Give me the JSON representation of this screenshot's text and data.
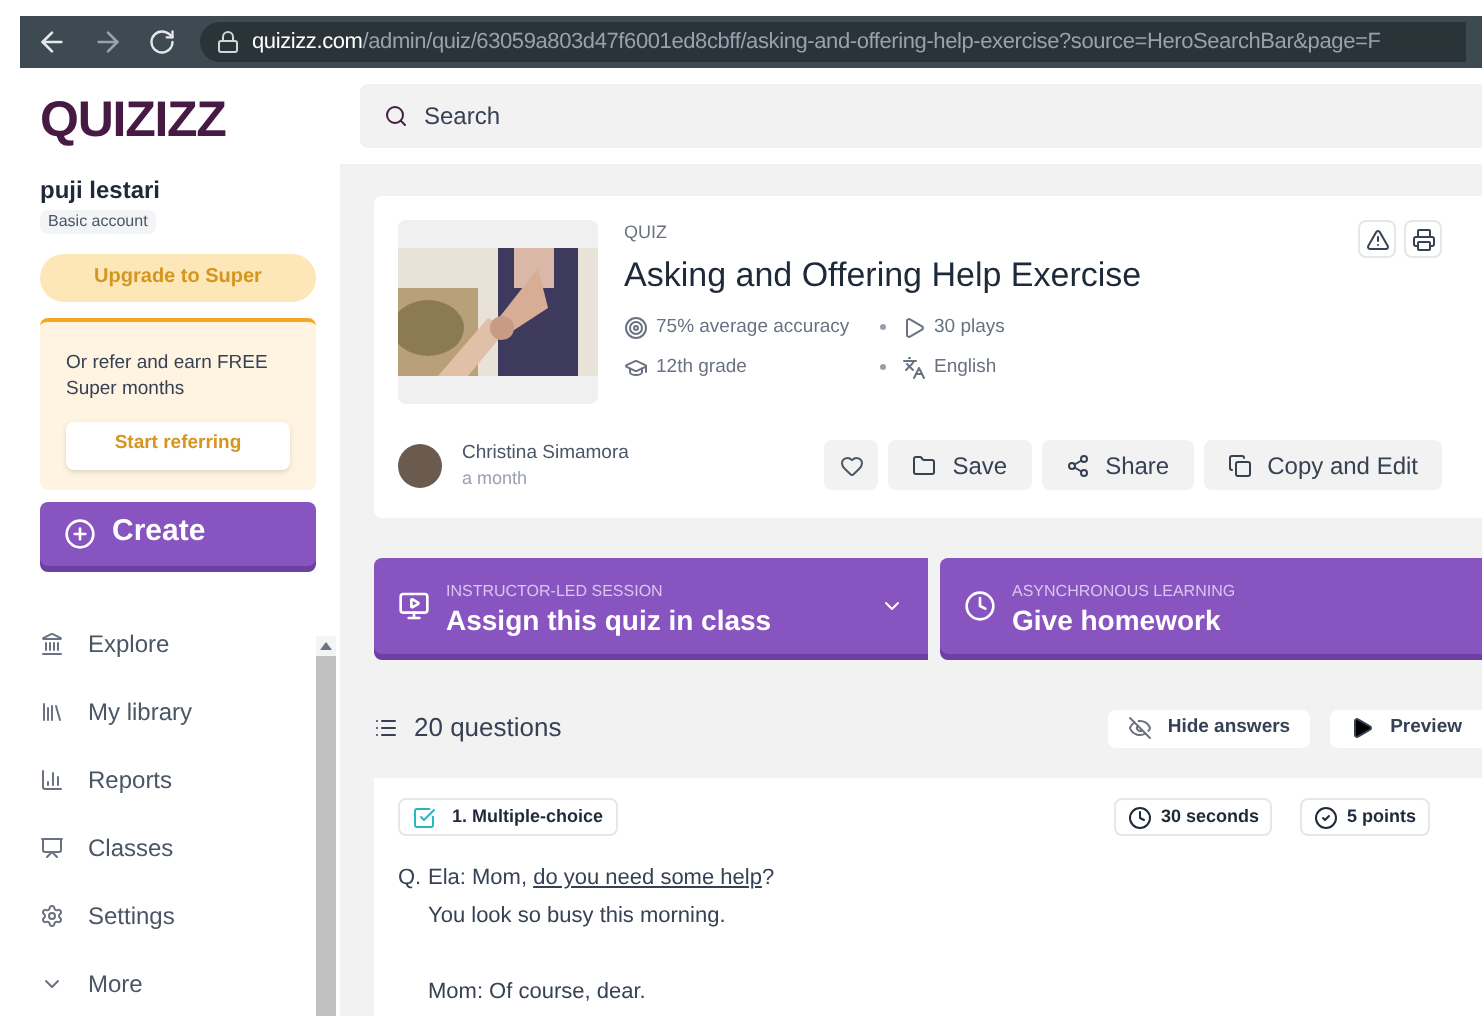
{
  "browser": {
    "url_host": "quizizz.com",
    "url_path": "/admin/quiz/63059a803d47f6001ed8cbff/asking-and-offering-help-exercise?source=HeroSearchBar&page=F"
  },
  "sidebar": {
    "logo": "QUIZIZZ",
    "user": "puji lestari",
    "account": "Basic account",
    "upgrade": "Upgrade to Super",
    "refer_text": "Or refer and earn FREE Super months",
    "refer_button": "Start referring",
    "create": "Create",
    "items": [
      {
        "label": "Explore"
      },
      {
        "label": "My library"
      },
      {
        "label": "Reports"
      },
      {
        "label": "Classes"
      },
      {
        "label": "Settings"
      },
      {
        "label": "More"
      }
    ]
  },
  "search": {
    "placeholder": "Search"
  },
  "quiz": {
    "type": "QUIZ",
    "title": "Asking and Offering Help Exercise",
    "accuracy": "75% average accuracy",
    "plays": "30 plays",
    "grade": "12th grade",
    "language": "English",
    "author": "Christina Simamora",
    "time": "a month",
    "actions": [
      "Save",
      "Share",
      "Copy and Edit"
    ]
  },
  "assign": [
    {
      "kind": "class",
      "caption": "INSTRUCTOR-LED SESSION",
      "label": "Assign this quiz in class"
    },
    {
      "kind": "homework",
      "caption": "ASYNCHRONOUS LEARNING",
      "label": "Give homework"
    }
  ],
  "questions": {
    "count": "20 questions",
    "hide": "Hide answers",
    "preview": "Preview"
  },
  "question": {
    "type": "1. Multiple-choice",
    "time": "30 seconds",
    "points": "5 points",
    "q": "Q.",
    "line1_before": "Ela: Mom, ",
    "line1_link": "do you need some help",
    "line1_after": "?",
    "line2": "You look so busy this morning.",
    "line3": "Mom: Of course, dear."
  }
}
